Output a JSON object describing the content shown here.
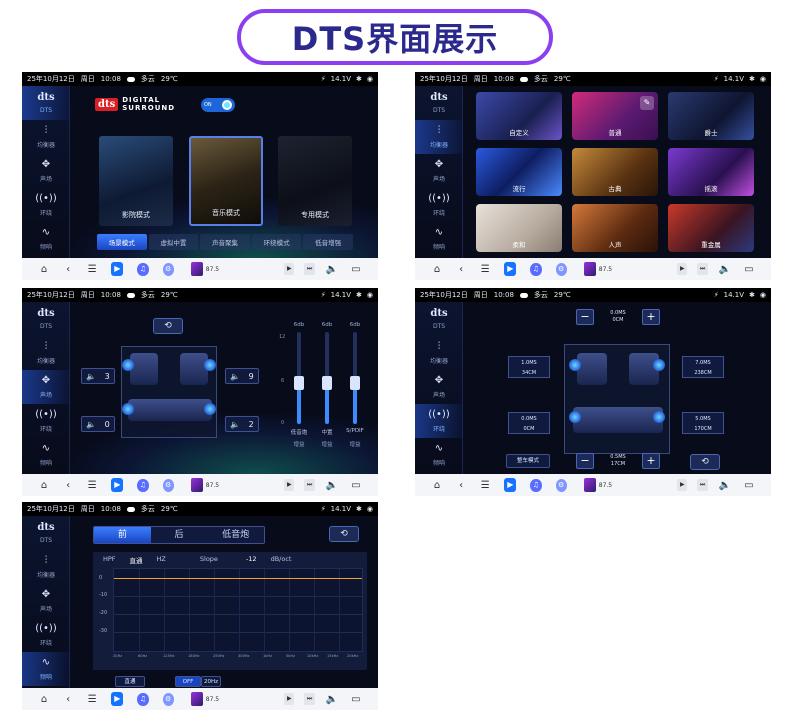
{
  "title": "DTS界面展示",
  "status": {
    "date": "25年10月12日",
    "weekday": "周日",
    "time": "10:08",
    "weather": "多云",
    "temp": "29℃",
    "voltage": "14.1V"
  },
  "sidebar": {
    "logo": "dts",
    "items": [
      {
        "label": "DTS",
        "icon": "dts-icon"
      },
      {
        "label": "均衡器",
        "icon": "equalizer-icon"
      },
      {
        "label": "声场",
        "icon": "soundfield-icon"
      },
      {
        "label": "环绕",
        "icon": "surround-icon"
      },
      {
        "label": "频响",
        "icon": "frequency-icon"
      }
    ]
  },
  "navbar": {
    "freq": "87.5"
  },
  "screen1": {
    "brand_box": "dts",
    "brand_line1": "DIGITAL",
    "brand_line2": "SURROUND",
    "toggle": "ON",
    "cards": [
      "影院模式",
      "音乐模式",
      "专用模式"
    ],
    "tabs": [
      "场景模式",
      "虚拟中置",
      "声音聚集",
      "环绕模式",
      "低音增强"
    ],
    "active_tab": 0
  },
  "screen2": {
    "tiles": [
      "自定义",
      "普通",
      "爵士",
      "流行",
      "古典",
      "摇滚",
      "柔和",
      "人声",
      "重金属"
    ]
  },
  "screen3": {
    "volumes": {
      "fl": "3",
      "fr": "9",
      "rl": "0",
      "rr": "2"
    },
    "sliders": [
      {
        "top": "6db",
        "name": "低音炮",
        "sub": "增益",
        "level": 0.45
      },
      {
        "top": "6db",
        "name": "中置",
        "sub": "增益",
        "level": 0.45
      },
      {
        "top": "6db",
        "name": "S/PDIF",
        "sub": "增益",
        "level": 0.45
      }
    ],
    "scale": [
      "12",
      "6",
      "0"
    ]
  },
  "screen4": {
    "top_stepper": {
      "ms": "0.0MS",
      "cm": "0CM"
    },
    "bottom_stepper": {
      "ms": "0.5MS",
      "cm": "17CM"
    },
    "fl": {
      "ms": "1.0MS",
      "cm": "34CM"
    },
    "fr": {
      "ms": "7.0MS",
      "cm": "238CM"
    },
    "rl": {
      "ms": "0.0MS",
      "cm": "0CM"
    },
    "rr": {
      "ms": "5.0MS",
      "cm": "170CM"
    },
    "mode": "整车模式"
  },
  "screen5": {
    "segments": [
      "前",
      "后",
      "低音炮"
    ],
    "active": 0,
    "hpf_label": "HPF",
    "hpf_value": "直通",
    "hpf_unit": "HZ",
    "slope_label": "Slope",
    "slope_value": "-12",
    "slope_unit": "dB/oct",
    "y_ticks": [
      "0",
      "-10",
      "-20",
      "-30"
    ],
    "x_ticks": [
      "20Hz",
      "60Hz",
      "125Hz",
      "180Hz",
      "250Hz",
      "300Hz",
      "1kHz",
      "5kHz",
      "10kHz",
      "15kHz",
      "20kHz"
    ],
    "bypass_btn": "直通",
    "off_btn": "OFF",
    "hz_btn": "20Hz"
  }
}
